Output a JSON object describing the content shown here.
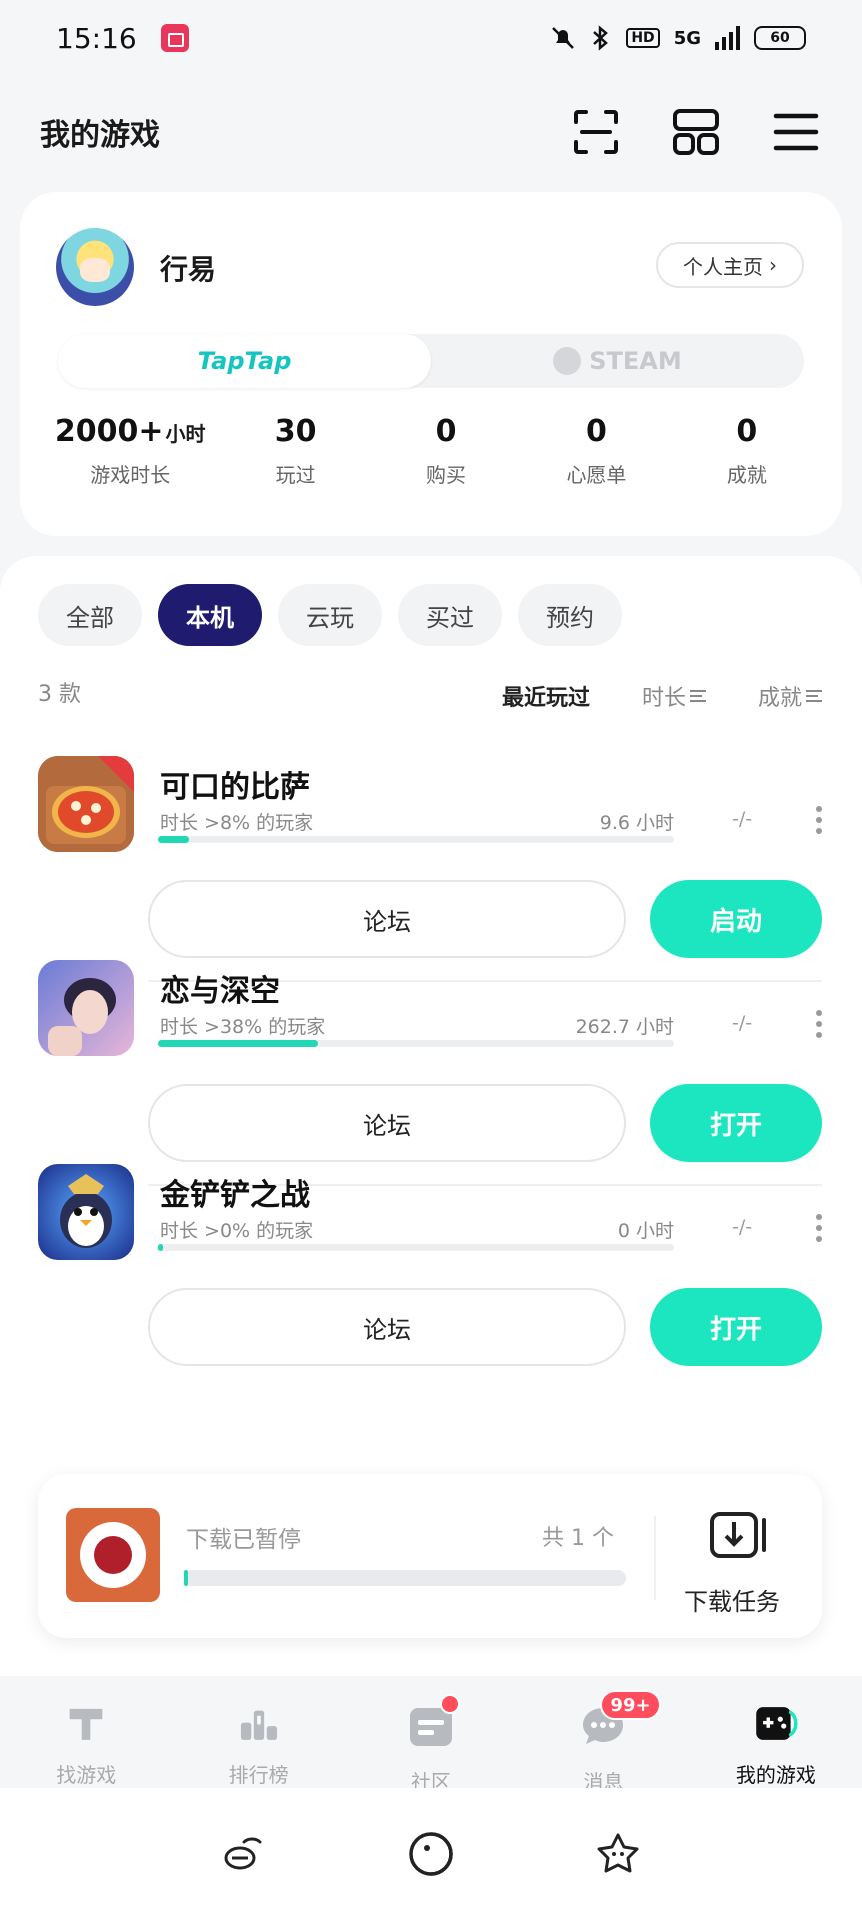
{
  "status_bar": {
    "time": "15:16",
    "network": "5G",
    "hd": "HD",
    "battery": "60"
  },
  "header": {
    "title": "我的游戏"
  },
  "profile": {
    "username": "行易",
    "homepage_label": "个人主页",
    "platforms": [
      "TapTap",
      "STEAM"
    ],
    "active_platform": "TapTap",
    "stats": [
      {
        "value": "2000+",
        "unit": "小时",
        "label": "游戏时长"
      },
      {
        "value": "30",
        "unit": "",
        "label": "玩过"
      },
      {
        "value": "0",
        "unit": "",
        "label": "购买"
      },
      {
        "value": "0",
        "unit": "",
        "label": "心愿单"
      },
      {
        "value": "0",
        "unit": "",
        "label": "成就"
      }
    ]
  },
  "filters": {
    "chips": [
      "全部",
      "本机",
      "云玩",
      "买过",
      "预约"
    ],
    "active": "本机"
  },
  "list": {
    "count_label": "3 款",
    "sort": {
      "recent": "最近玩过",
      "duration": "时长",
      "achievement": "成就"
    }
  },
  "games": [
    {
      "name": "可口的比萨",
      "rank_text": "时长 >8% 的玩家",
      "hours": "9.6 小时",
      "progress": 0.06,
      "achievement": "-/-",
      "forum_label": "论坛",
      "action_label": "启动"
    },
    {
      "name": "恋与深空",
      "rank_text": "时长 >38% 的玩家",
      "hours": "262.7 小时",
      "progress": 0.31,
      "achievement": "-/-",
      "forum_label": "论坛",
      "action_label": "打开"
    },
    {
      "name": "金铲铲之战",
      "rank_text": "时长 >0% 的玩家",
      "hours": "0 小时",
      "progress": 0.005,
      "achievement": "-/-",
      "forum_label": "论坛",
      "action_label": "打开"
    }
  ],
  "download": {
    "status": "下载已暂停",
    "total": "共 1 个",
    "progress": 0.01,
    "task_label": "下载任务"
  },
  "bottom_nav": {
    "items": [
      {
        "label": "找游戏",
        "icon": "find-games-icon"
      },
      {
        "label": "排行榜",
        "icon": "ranking-icon"
      },
      {
        "label": "社区",
        "icon": "community-icon"
      },
      {
        "label": "消息",
        "icon": "message-icon",
        "badge": "99+"
      },
      {
        "label": "我的游戏",
        "icon": "my-games-icon"
      }
    ],
    "active": "我的游戏"
  },
  "colors": {
    "accent": "#1ce6bf",
    "chip_active": "#1f1b6e",
    "badge": "#ff4d5e"
  }
}
